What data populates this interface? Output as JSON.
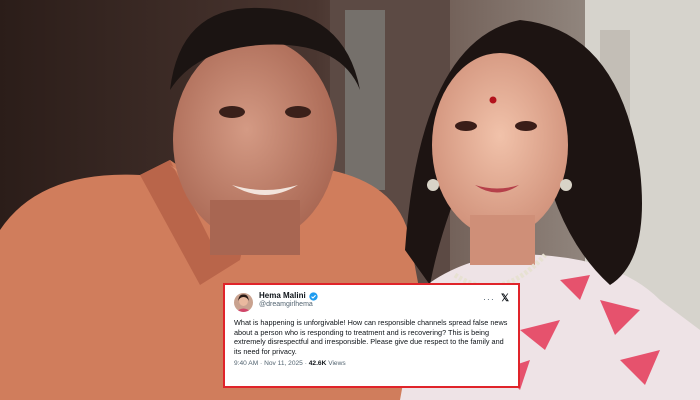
{
  "tweet": {
    "author_name": "Hema Malini",
    "handle": "@dreamgirlhema",
    "text": "What is happening is unforgivable! How can responsible channels spread false news about a person who is responding to treatment and is recovering? This is being extremely disrespectful and  irresponsible. Please give due respect to the family and its need for privacy.",
    "time": "9:40 AM",
    "date": "Nov 11, 2025",
    "separator": "·",
    "views_count": "42.6K",
    "views_label": "Views",
    "more_glyph": "···",
    "platform_glyph": "𝕏"
  },
  "colors": {
    "card_border": "#e0242a",
    "verified_badge": "#1d9bf0",
    "muted_text": "#536471"
  },
  "icons": [
    "verified-badge-icon",
    "more-options-icon",
    "x-logo-icon"
  ]
}
